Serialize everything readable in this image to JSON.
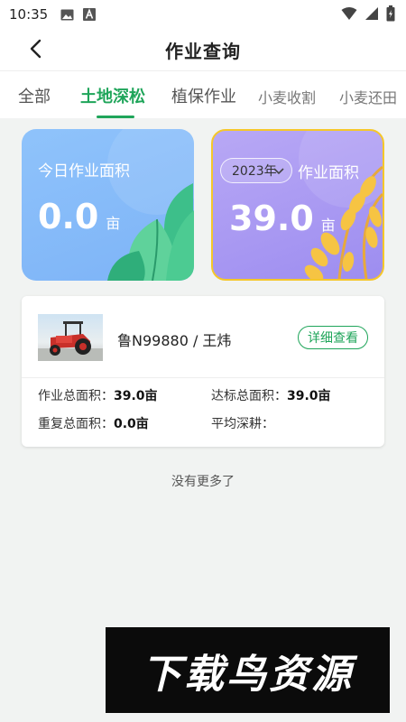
{
  "status_bar": {
    "time": "10:35",
    "icons": [
      "image-icon",
      "text-a-icon",
      "wifi-icon",
      "signal-icon",
      "battery-icon"
    ]
  },
  "header": {
    "title": "作业查询",
    "back_icon": "back-arrow-icon"
  },
  "tabs": [
    {
      "label": "全部",
      "active": false
    },
    {
      "label": "土地深松",
      "active": true
    },
    {
      "label": "植保作业",
      "active": false
    },
    {
      "label": "小麦收割",
      "active": false
    },
    {
      "label": "小麦还田",
      "active": false
    }
  ],
  "accent_color": "#1fa55a",
  "cards": {
    "today": {
      "label": "今日作业面积",
      "value": "0.0",
      "unit": "亩"
    },
    "year": {
      "year_selected": "2023年",
      "label": "作业面积",
      "value": "39.0",
      "unit": "亩"
    }
  },
  "vehicle": {
    "name": "鲁N99880 / 王炜",
    "detail_button": "详细查看",
    "stats": {
      "total_area_label": "作业总面积：",
      "total_area_value": "39.0亩",
      "qualified_area_label": "达标总面积：",
      "qualified_area_value": "39.0亩",
      "repeat_area_label": "重复总面积：",
      "repeat_area_value": "0.0亩",
      "avg_depth_label": "平均深耕：",
      "avg_depth_value": ""
    }
  },
  "list_footer": "没有更多了",
  "watermark": "下载鸟资源"
}
